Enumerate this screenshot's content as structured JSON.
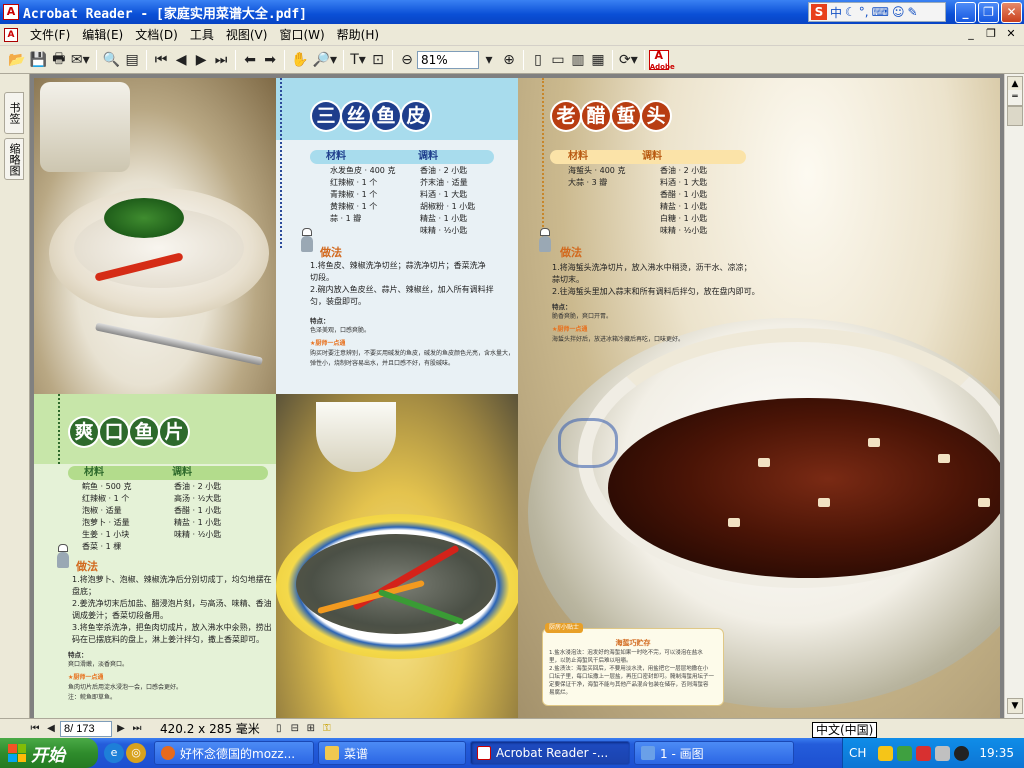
{
  "window": {
    "title": "Acrobat Reader - [家庭实用菜谱大全.pdf]",
    "app_icon": "acrobat-icon",
    "ime_toolbar": {
      "s_label": "S",
      "cn": "中",
      "punct": "°,"
    },
    "buttons": {
      "minimize": "_",
      "restore": "❐",
      "close": "✕"
    }
  },
  "menu": {
    "items": [
      "文件(F)",
      "编辑(E)",
      "文档(D)",
      "工具",
      "视图(V)",
      "窗口(W)",
      "帮助(H)"
    ],
    "mdi": {
      "minimize": "_",
      "restore": "❐",
      "close": "✕"
    }
  },
  "toolbar": {
    "zoom_value": "81%",
    "adobe_label": "Adobe"
  },
  "side_tabs": {
    "bookmarks": "书签",
    "thumbnails": "缩略图"
  },
  "document": {
    "left_top_title": [
      "三",
      "丝",
      "鱼",
      "皮"
    ],
    "left_top_table": {
      "h1": "材料",
      "h2": "调料",
      "col1": [
        "水发鱼皮 · 400 克",
        "红辣椒 · 1 个",
        "青辣椒 · 1 个",
        "黄辣椒 · 1 个",
        "蒜 · 1 瓣"
      ],
      "col2": [
        "香油 · 2 小匙",
        "芥末油 · 适量",
        "料酒 · 1 大匙",
        "胡椒粉 · 1 小匙",
        "精盐 · 1 小匙",
        "味精 · ½小匙"
      ]
    },
    "left_top_method": "做法",
    "left_top_steps": [
      "1.将鱼皮、辣椒洗净切丝；蒜洗净切片；香菜洗净",
      "   切段。",
      "2.碗内放入鱼皮丝、蒜片、辣椒丝，加入所有调料拌",
      "   匀，装盘即可。"
    ],
    "left_top_feature_label": "特点：",
    "left_top_feature": "色泽美观，口感爽脆。",
    "left_top_tip_label": "★厨师一点通",
    "left_top_tip": "购买时要注意辨别，不要买用碱发的鱼皮，碱发的鱼皮颜色光亮，含水量大，弹性小，烧制时容易出水，并且口感不好，有股碱味。",
    "left_bottom_title": [
      "爽",
      "口",
      "鱼",
      "片"
    ],
    "left_bottom_table": {
      "h1": "材料",
      "h2": "调料",
      "col1": [
        "鲩鱼 · 500 克",
        "红辣椒 · 1 个",
        "泡椒 · 适量",
        "泡萝卜 · 适量",
        "生姜 · 1 小块",
        "香菜 · 1 棵"
      ],
      "col2": [
        "香油 · 2 小匙",
        "高汤 · ½大匙",
        "香醋 · 1 小匙",
        "精盐 · 1 小匙",
        "味精 · ½小匙"
      ]
    },
    "left_bottom_method": "做法",
    "left_bottom_steps": [
      "1.将泡萝卜、泡椒、辣椒洗净后分别切成丁，均匀地摆在",
      "   盘底；",
      "2.姜洗净切末后加盐、醋浸泡片刻，与高汤、味精、香油",
      "   调成姜汁；香菜切段备用。",
      "3.将鱼宰杀洗净，把鱼肉切成片，放入沸水中氽熟，捞出",
      "   码在已摆底料的盘上，淋上姜汁拌匀，撒上香菜即可。"
    ],
    "left_bottom_feature_label": "特点：",
    "left_bottom_feature": "爽口滑嫩，淡香爽口。",
    "left_bottom_tip_label": "★厨师一点通",
    "left_bottom_tip": "鱼肉切片后用淀水浸泡一会，口感会更好。",
    "left_bottom_tip2": "注：鲩鱼即草鱼。",
    "right_title": [
      "老",
      "醋",
      "蜇",
      "头"
    ],
    "right_table": {
      "h1": "材料",
      "h2": "调料",
      "col1": [
        "海蜇头 · 400 克",
        "大蒜 · 3 瓣"
      ],
      "col2": [
        "香油 · 2 小匙",
        "料酒 · 1 大匙",
        "香醋 · 1 小匙",
        "精盐 · 1 小匙",
        "白糖 · 1 小匙",
        "味精 · ½小匙"
      ]
    },
    "right_method": "做法",
    "right_steps": [
      "1.将海蜇头洗净切片，放入沸水中稍烫，沥干水、凉凉；",
      "   蒜切末。",
      "2.往海蜇头里加入蒜末和所有调料后拌匀，放在盘内即可。"
    ],
    "right_feature_label": "特点：",
    "right_feature": "脆香爽脆，爽口开胃。",
    "right_tip_label": "★厨师一点通",
    "right_tip": "海蜇头拌好后，放进冰箱冷藏后再吃，口味更好。",
    "tipbox_tag": "厨房小贴士",
    "tipbox_title": "海蜇巧贮存",
    "tipbox_lines": [
      "1.盐水浸泡法：泡发好的海蜇如果一时吃不完，可以浸泡在盐水",
      "里，以防止海蜇风干后难以咀嚼。",
      "2.盐渍法：海蜇买回后，不要用淡水洗，用盐把它一层层地撒在小",
      "口坛子里，每口坛撒上一层盐，再压口密封即可。腌制海蜇用坛子一",
      "定要保证干净，海蜇不能与其他产品混合包装在储存，否则海蜇容",
      "易腐烂。"
    ]
  },
  "statusbar": {
    "page_field": "8/ 173",
    "page_size": "420.2 x 285 毫米",
    "ime_tooltip": "中文(中国)"
  },
  "taskbar": {
    "start_label": "开始",
    "tasks": [
      {
        "label": "好怀念德国的mozz...",
        "icon": "firefox-icon"
      },
      {
        "label": "菜谱",
        "icon": "folder-icon"
      },
      {
        "label": "Acrobat Reader -...",
        "icon": "acrobat-icon"
      },
      {
        "label": "1 - 画图",
        "icon": "paint-icon"
      }
    ],
    "lang": "CH",
    "clock": "19:35"
  },
  "colors": {
    "title_blue": "#0a4fd6",
    "taskbar_blue": "#245ddb",
    "start_green": "#2f8c2c",
    "panel_blue_head": "#a8dced",
    "panel_green_head": "#c7e6a9"
  }
}
